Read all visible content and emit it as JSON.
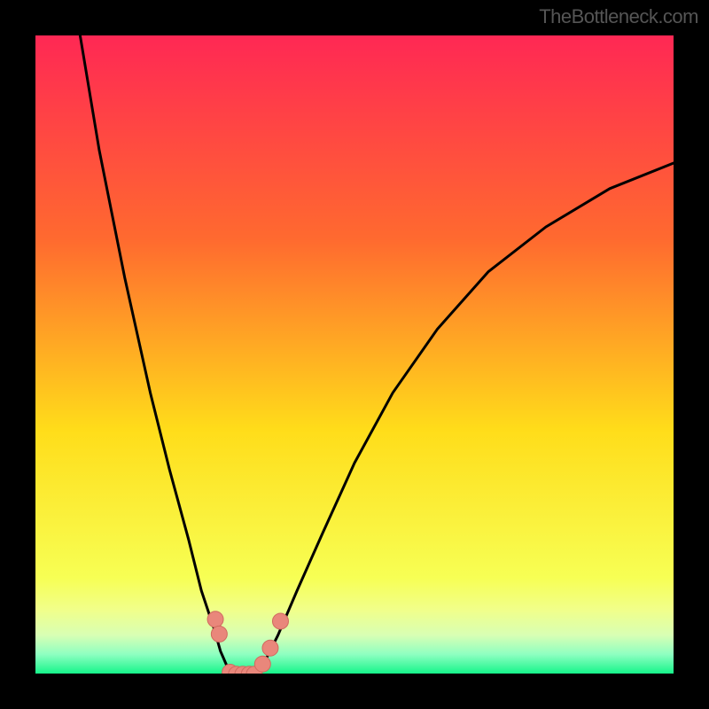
{
  "watermark": "TheBottleneck.com",
  "colors": {
    "black": "#000000",
    "curve": "#000000",
    "marker_fill": "#e9877b",
    "marker_stroke": "#d06a5f",
    "grad_top": "#ff2854",
    "grad_upper": "#ff6a2f",
    "grad_mid": "#ffdd1a",
    "grad_lower": "#f7ff54",
    "grad_band1": "#f1ff8a",
    "grad_band2": "#d8ffb4",
    "grad_band3": "#8effc1",
    "grad_bottom": "#16f58a"
  },
  "chart_data": {
    "type": "line",
    "title": "",
    "xlabel": "",
    "ylabel": "",
    "xlim": [
      0,
      100
    ],
    "ylim": [
      0,
      100
    ],
    "series": [
      {
        "name": "left-branch",
        "x": [
          7,
          10,
          14,
          18,
          21,
          24,
          26,
          28,
          29,
          30,
          30.5
        ],
        "y": [
          100,
          82,
          62,
          44,
          32,
          21,
          13,
          7,
          3.5,
          1.2,
          0
        ]
      },
      {
        "name": "right-branch",
        "x": [
          34.5,
          36,
          38,
          41,
          45,
          50,
          56,
          63,
          71,
          80,
          90,
          100
        ],
        "y": [
          0,
          2,
          6,
          13,
          22,
          33,
          44,
          54,
          63,
          70,
          76,
          80
        ]
      },
      {
        "name": "valley-floor",
        "x": [
          30.5,
          31.5,
          32.5,
          33.5,
          34.5
        ],
        "y": [
          0,
          -0.1,
          -0.1,
          -0.1,
          0
        ]
      }
    ],
    "markers": [
      {
        "x": 28.2,
        "y": 8.5
      },
      {
        "x": 28.8,
        "y": 6.2
      },
      {
        "x": 30.5,
        "y": 0.2
      },
      {
        "x": 31.5,
        "y": -0.1
      },
      {
        "x": 32.5,
        "y": -0.1
      },
      {
        "x": 33.5,
        "y": -0.1
      },
      {
        "x": 34.3,
        "y": -0.1
      },
      {
        "x": 35.6,
        "y": 1.5
      },
      {
        "x": 36.8,
        "y": 4.0
      },
      {
        "x": 38.4,
        "y": 8.2
      }
    ],
    "background_bands": [
      {
        "y": 100,
        "color_key": "grad_top"
      },
      {
        "y": 68,
        "color_key": "grad_upper"
      },
      {
        "y": 38,
        "color_key": "grad_mid"
      },
      {
        "y": 15,
        "color_key": "grad_lower"
      },
      {
        "y": 10,
        "color_key": "grad_band1"
      },
      {
        "y": 6,
        "color_key": "grad_band2"
      },
      {
        "y": 3,
        "color_key": "grad_band3"
      },
      {
        "y": 0,
        "color_key": "grad_bottom"
      }
    ]
  }
}
